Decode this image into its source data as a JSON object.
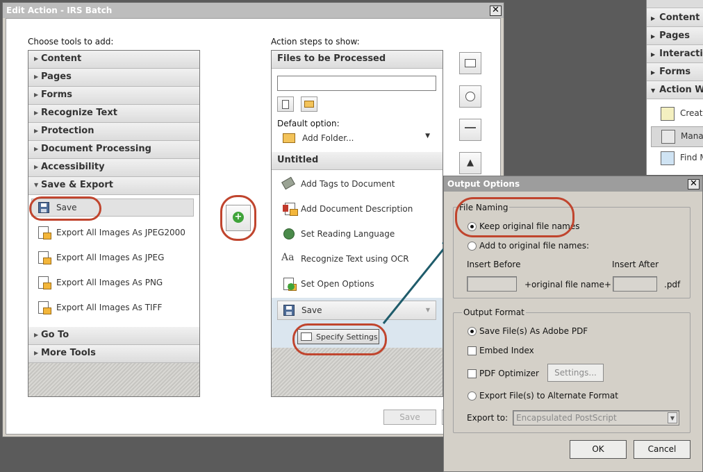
{
  "main_dialog": {
    "title": "Edit Action - IRS Batch",
    "close": "✕",
    "tools_label": "Choose tools to add:",
    "steps_label": "Action steps to show:",
    "categories": [
      "Content",
      "Pages",
      "Forms",
      "Recognize Text",
      "Protection",
      "Document Processing",
      "Accessibility",
      "Save & Export"
    ],
    "categories_after": [
      "Go To",
      "More Tools"
    ],
    "save_export_tools": [
      "Save",
      "Export All Images As JPEG2000",
      "Export All Images As JPEG",
      "Export All Images As PNG",
      "Export All Images As TIFF"
    ],
    "add_button": "+",
    "files_header": "Files to be Processed",
    "files_field_value": "",
    "default_option_label": "Default option:",
    "default_option_value": "Add Folder...",
    "untitled_header": "Untitled",
    "steps": [
      "Add Tags to Document",
      "Add Document Description",
      "Set Reading Language",
      "Recognize Text using OCR",
      "Set Open Options"
    ],
    "save_step": "Save",
    "specify_settings": "Specify Settings",
    "save_button": "Save",
    "up_arrow": "▲"
  },
  "output_options": {
    "title": "Output Options",
    "close": "✕",
    "file_naming": {
      "label": "File Naming",
      "keep_original": "Keep original file names",
      "add_to_original": "Add to original file names:",
      "insert_before": "Insert Before",
      "insert_after": "Insert After",
      "middle_text": "+original file name+",
      "ext_text": ".pdf",
      "selected": "keep_original"
    },
    "output_format": {
      "label": "Output Format",
      "save_as_pdf": "Save File(s) As Adobe PDF",
      "embed_index": "Embed Index",
      "pdf_optimizer": "PDF Optimizer",
      "settings_button": "Settings...",
      "export_alternate": "Export File(s) to Alternate Format",
      "export_to_label": "Export to:",
      "export_to_value": "Encapsulated PostScript",
      "selected": "save_as_pdf"
    },
    "ok": "OK",
    "cancel": "Cancel"
  },
  "side_panel": {
    "categories": [
      "Content Editing",
      "Pages",
      "Interactive Objects",
      "Forms",
      "Action Wizard"
    ],
    "items": [
      "Create New Action...",
      "Manage Actions...",
      "Find More Actions..."
    ]
  },
  "colors": {
    "highlight": "#c0452e",
    "arrow": "#1f5c6b"
  }
}
